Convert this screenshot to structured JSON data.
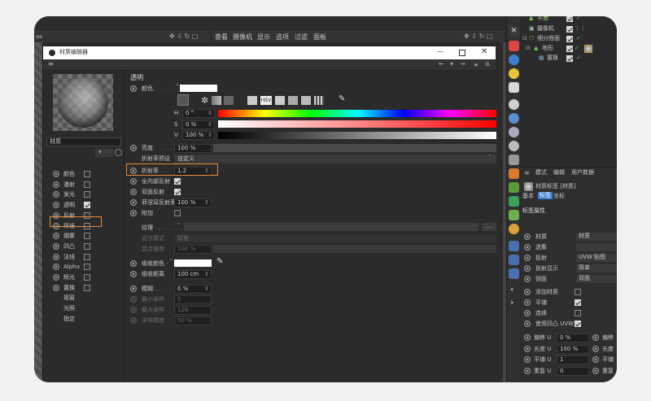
{
  "right_panel": {
    "tabs": [
      "模式",
      "编辑",
      "用户数据"
    ],
    "object_label": "材质标签 [材质]",
    "subtabs": [
      "基本",
      "标签",
      "坐标"
    ],
    "section": "标签属性",
    "rows": [
      {
        "label": "材质",
        "value": "材质"
      },
      {
        "label": "选集",
        "value": ""
      },
      {
        "label": "投射",
        "value": "UVW 贴图"
      },
      {
        "label": "投射显示",
        "value": "简单"
      },
      {
        "label": "侧面",
        "value": "双面"
      }
    ],
    "checks": [
      {
        "label": "添加材质",
        "checked": false
      },
      {
        "label": "平铺",
        "checked": true
      },
      {
        "label": "连续",
        "checked": false
      },
      {
        "label": "使用凹凸 UVW",
        "checked": true
      }
    ],
    "coords": [
      {
        "label": "偏移 U",
        "value": "0 %",
        "right": "偏移"
      },
      {
        "label": "长度 U",
        "value": "100 %",
        "right": "长度"
      },
      {
        "label": "平铺 U",
        "value": "1",
        "right": "平铺"
      },
      {
        "label": "重复 U",
        "value": "0",
        "right": "重复"
      }
    ]
  },
  "object_tree": {
    "items": [
      "平面",
      "摄像机",
      "细分曲面",
      "地形",
      "置换"
    ]
  },
  "viewport_menu": [
    "查看",
    "摄像机",
    "显示",
    "选项",
    "过滤",
    "面板"
  ],
  "editor": {
    "title": "材质编辑器",
    "material_name": "材质",
    "channels": [
      {
        "label": "颜色",
        "checked": false,
        "has_box": true
      },
      {
        "label": "漫射",
        "checked": false,
        "has_box": true
      },
      {
        "label": "发光",
        "checked": false,
        "has_box": true
      },
      {
        "label": "透明",
        "checked": true,
        "has_box": true
      },
      {
        "label": "反射",
        "checked": false,
        "has_box": true
      },
      {
        "label": "环境",
        "checked": false,
        "has_box": true
      },
      {
        "label": "烟雾",
        "checked": false,
        "has_box": true
      },
      {
        "label": "凹凸",
        "checked": false,
        "has_box": true
      },
      {
        "label": "法线",
        "checked": false,
        "has_box": true
      },
      {
        "label": "Alpha",
        "checked": false,
        "has_box": true
      },
      {
        "label": "辉光",
        "checked": false,
        "has_box": true
      },
      {
        "label": "置换",
        "checked": false,
        "has_box": true
      },
      {
        "label": "视窗",
        "checked": false,
        "has_box": false
      },
      {
        "label": "光照",
        "checked": false,
        "has_box": false
      },
      {
        "label": "指定",
        "checked": false,
        "has_box": false
      }
    ],
    "section_title": "透明",
    "color_label": "颜色",
    "hsv": [
      {
        "label": "H",
        "value": "0 °"
      },
      {
        "label": "S",
        "value": "0 %"
      },
      {
        "label": "V",
        "value": "100 %"
      }
    ],
    "brightness": {
      "label": "亮度",
      "value": "100 %"
    },
    "preset": {
      "label": "折射率预设",
      "value": "自定义"
    },
    "ior": {
      "label": "折射率",
      "value": "1.2"
    },
    "total_internal": {
      "label": "全内部反射",
      "checked": true
    },
    "double_sided": {
      "label": "双面反射",
      "checked": true
    },
    "fresnel": {
      "label": "菲涅耳反射率",
      "value": "100 %"
    },
    "additive": {
      "label": "附加",
      "checked": false
    },
    "texture_label": "纹理",
    "mix_mode": {
      "label": "混合模式",
      "value": "标准"
    },
    "mix_strength": {
      "label": "混合强度",
      "value": "100 %"
    },
    "absorb_color": {
      "label": "吸收颜色"
    },
    "absorb_dist": {
      "label": "吸收距离",
      "value": "100 cm"
    },
    "blur": {
      "label": "模糊",
      "value": "0 %"
    },
    "min_samples": {
      "label": "最小采样",
      "value": "5"
    },
    "max_samples": {
      "label": "最大采样",
      "value": "128"
    },
    "accuracy": {
      "label": "采样精度",
      "value": "50 %"
    }
  },
  "colors": {
    "accent": "#e88a3a",
    "blue": "#3d7fd0"
  }
}
